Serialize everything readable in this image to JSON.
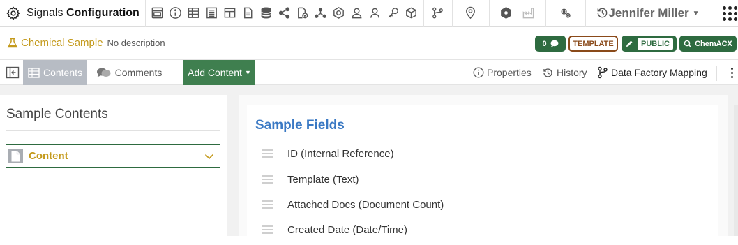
{
  "app": {
    "brand_prefix": "Signals",
    "brand_bold": "Configuration",
    "user_name": "Jennifer Miller"
  },
  "top_icons": {
    "group1": [
      "layout-icon",
      "info-icon",
      "table-icon",
      "list-table-icon",
      "grid-table-icon",
      "document-icon",
      "database-icon",
      "share-icon",
      "document-check-icon",
      "network-icon",
      "chemistry-icon",
      "user-icon",
      "users-icon",
      "key-icon",
      "cube-icon"
    ],
    "group2": [
      "workflow-icon"
    ],
    "group3": [
      "location-icon"
    ],
    "group4": [
      "hexagon-icon",
      "factory-icon"
    ],
    "group5": [
      "settings-gears-icon"
    ],
    "group6": [
      "history-icon"
    ]
  },
  "entity": {
    "name": "Chemical Sample",
    "description": "No description"
  },
  "badges": {
    "comments_count": "0",
    "template": "TEMPLATE",
    "public": "PUBLIC",
    "chemacx": "ChemACX"
  },
  "toolbar": {
    "contents": "Contents",
    "comments": "Comments",
    "add_content": "Add Content",
    "properties": "Properties",
    "history": "History",
    "data_factory_mapping": "Data Factory Mapping"
  },
  "left_panel": {
    "title": "Sample Contents",
    "section_label": "Content"
  },
  "right_panel": {
    "title": "Sample Fields",
    "fields": [
      "ID (Internal Reference)",
      "Template (Text)",
      "Attached Docs (Document Count)",
      "Created Date (Date/Time)"
    ]
  },
  "colors": {
    "accent_green": "#2e6b40",
    "gold": "#c49a1c",
    "blue_title": "#3a79c4",
    "template_brown": "#8a4a1a"
  }
}
